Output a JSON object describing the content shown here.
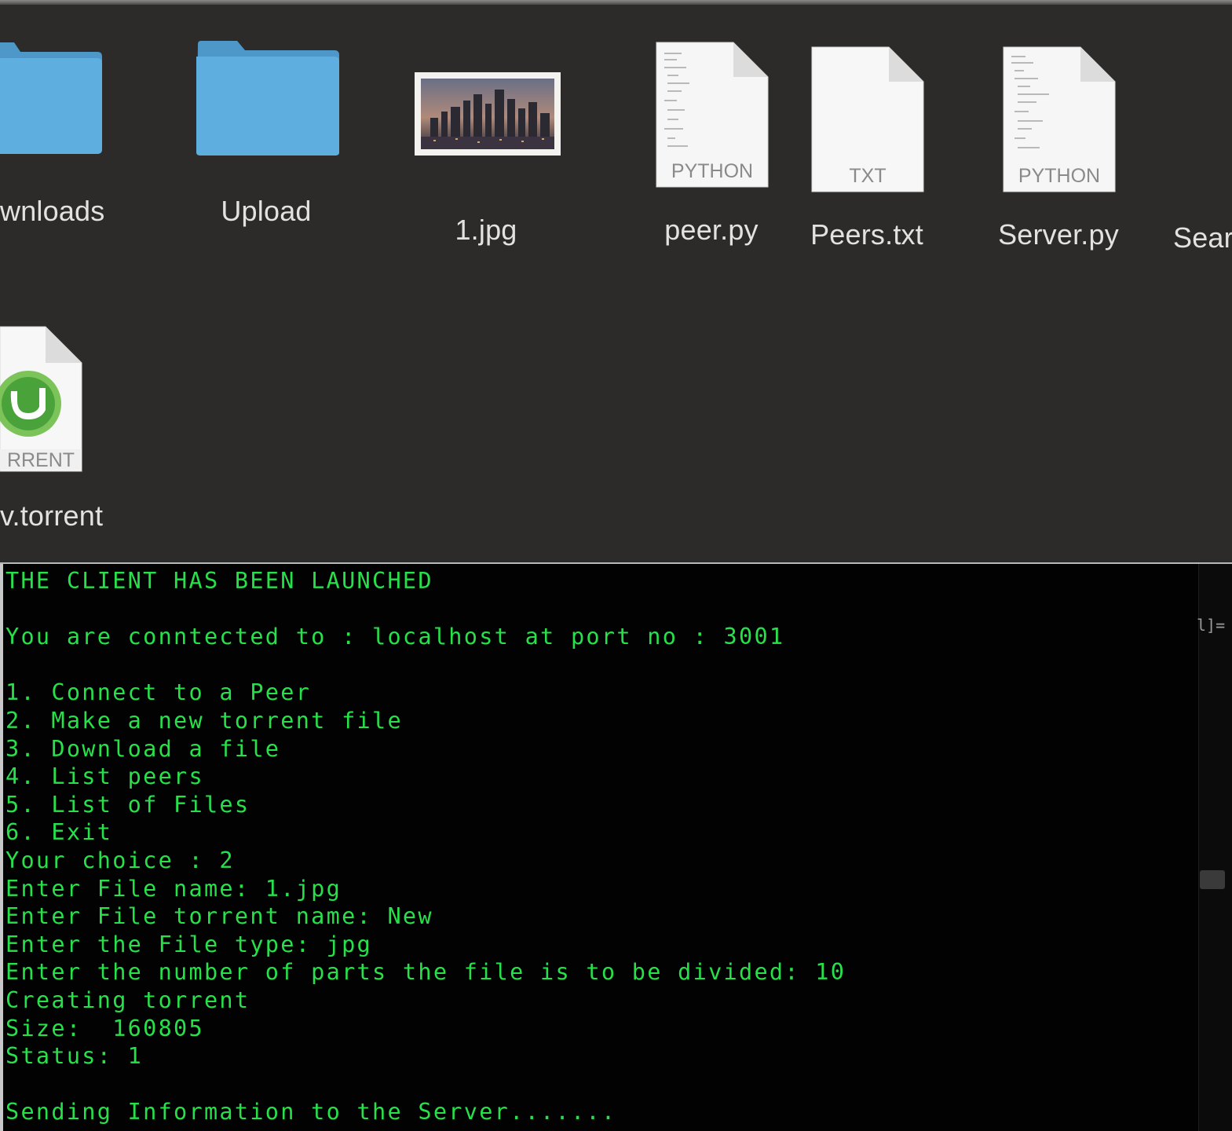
{
  "finder": {
    "items": [
      {
        "name": "Downloads",
        "visible_label": "wnloads",
        "kind": "folder",
        "icon": "folder-icon"
      },
      {
        "name": "Upload",
        "visible_label": "Upload",
        "kind": "folder",
        "icon": "folder-icon"
      },
      {
        "name": "1.jpg",
        "visible_label": "1.jpg",
        "kind": "image",
        "icon": "image-thumbnail-icon"
      },
      {
        "name": "peer.py",
        "visible_label": "peer.py",
        "kind": "document",
        "badge": "PYTHON",
        "icon": "python-file-icon"
      },
      {
        "name": "Peers.txt",
        "visible_label": "Peers.txt",
        "kind": "document",
        "badge": "TXT",
        "icon": "text-file-icon"
      },
      {
        "name": "Server.py",
        "visible_label": "Server.py",
        "kind": "document",
        "badge": "PYTHON",
        "icon": "python-file-icon"
      },
      {
        "name": "Search",
        "visible_label": "Sear",
        "kind": "unknown",
        "icon": ""
      },
      {
        "name": "New.torrent",
        "visible_label": "v.torrent",
        "kind": "torrent",
        "badge": "RRENT",
        "icon": "utorrent-file-icon"
      }
    ]
  },
  "terminal": {
    "lines": [
      "THE CLIENT HAS BEEN LAUNCHED",
      "",
      "You are conntected to : localhost at port no : 3001",
      "",
      "1. Connect to a Peer",
      "2. Make a new torrent file",
      "3. Download a file",
      "4. List peers",
      "5. List of Files",
      "6. Exit",
      "Your choice : 2",
      "Enter File name: 1.jpg",
      "Enter File torrent name: New",
      "Enter the File type: jpg",
      "Enter the number of parts the file is to be divided: 10",
      "Creating torrent",
      "Size:  160805",
      "Status: 1",
      "",
      "Sending Information to the Server......."
    ],
    "side_glyph": "l]=",
    "text_color": "#27e04a",
    "background": "#020202"
  },
  "colors": {
    "finder_background": "#2d2b2a",
    "folder_blue": "#5aa9dc",
    "label_text": "#e4e2e0"
  }
}
